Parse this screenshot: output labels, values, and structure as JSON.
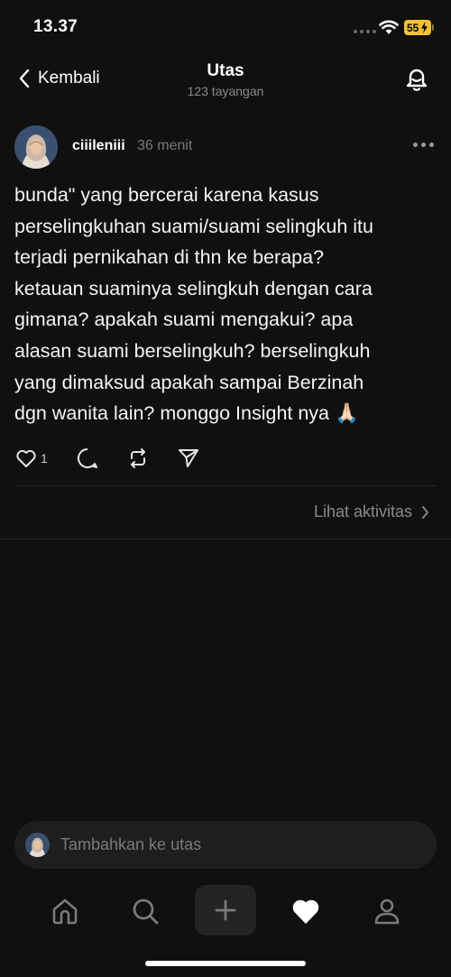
{
  "status_bar": {
    "time": "13.37",
    "battery": "55"
  },
  "header": {
    "back_label": "Kembali",
    "title": "Utas",
    "subtitle": "123 tayangan"
  },
  "post": {
    "username": "ciiileniii",
    "time_ago": "36 menit",
    "text_lines": [
      "bunda\" yang bercerai karena kasus",
      "perselingkuhan suami/suami selingkuh itu",
      "terjadi pernikahan di thn ke berapa?",
      "ketauan suaminya selingkuh dengan cara",
      "gimana? apakah suami mengakui? apa",
      "alasan suami berselingkuh? berselingkuh",
      "yang dimaksud apakah sampai Berzinah",
      "dgn wanita lain? monggo Insight nya 🙏🏻"
    ],
    "like_count": "1"
  },
  "activity_link": "Lihat aktivitas",
  "reply_bar": {
    "placeholder": "Tambahkan ke utas"
  },
  "tabs": [
    "home-icon",
    "search-icon",
    "plus-icon",
    "heart-icon",
    "profile-icon"
  ]
}
